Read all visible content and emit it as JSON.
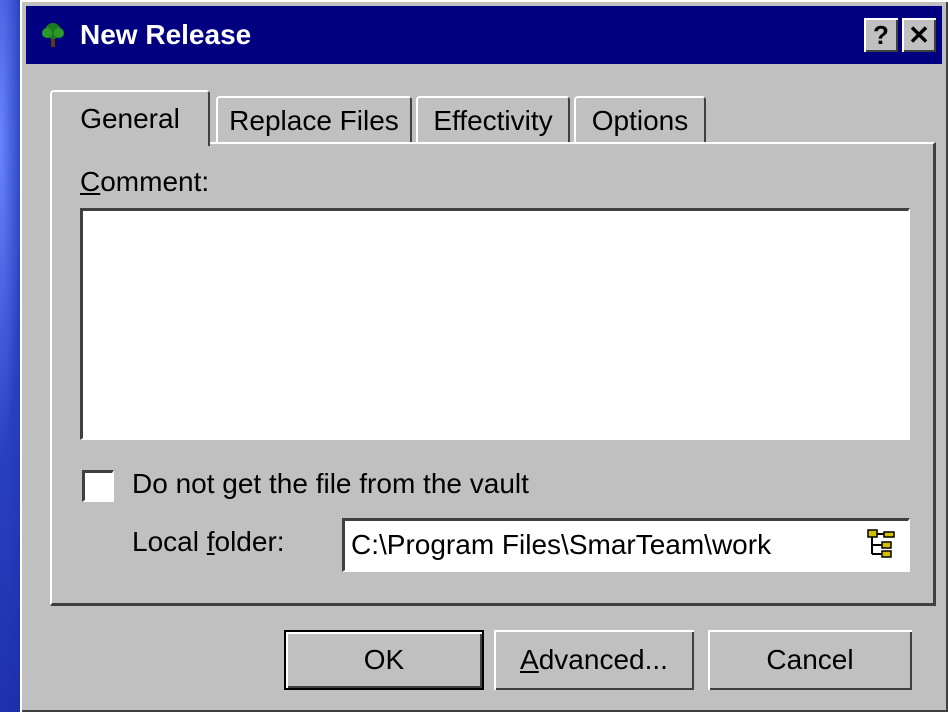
{
  "dialog": {
    "title": "New Release",
    "help_button": "?",
    "close_button": "✕"
  },
  "tabs": [
    {
      "label": "General",
      "active": true
    },
    {
      "label": "Replace Files",
      "active": false
    },
    {
      "label": "Effectivity",
      "active": false
    },
    {
      "label": "Options",
      "active": false
    }
  ],
  "general": {
    "comment_label_underlined": "C",
    "comment_label_rest": "omment:",
    "comment_value": "",
    "checkbox": {
      "label_before": "Do not ",
      "label_underlined": "g",
      "label_after": "et the file from the vault",
      "checked": false
    },
    "local_folder": {
      "label_before": "Local ",
      "label_underlined": "f",
      "label_after": "older:",
      "value": "C:\\Program Files\\SmarTeam\\work"
    }
  },
  "buttons": {
    "ok": "OK",
    "advanced_underlined": "A",
    "advanced_rest": "dvanced...",
    "cancel": "Cancel"
  },
  "icons": {
    "title": "tree-app-icon",
    "browse": "folder-tree-browse-icon"
  },
  "colors": {
    "titlebar": "#000080",
    "dialog_face": "#c0c0c0"
  }
}
